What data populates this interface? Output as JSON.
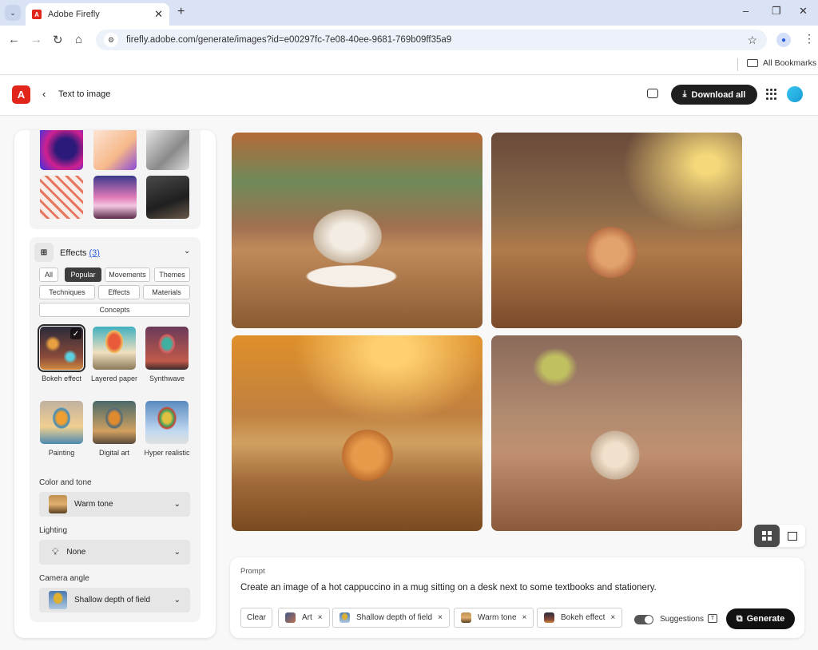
{
  "browser": {
    "tab_title": "Adobe Firefly",
    "url": "firefly.adobe.com/generate/images?id=e00297fc-7e08-40ee-9681-769b09ff35a9",
    "bookmarks_label": "All Bookmarks"
  },
  "header": {
    "logo_glyph": "A",
    "back_glyph": "<",
    "title": "Text to image",
    "download_all_label": "Download all",
    "accent_color": "#e1251b"
  },
  "sidebar": {
    "style_thumbs": [
      {
        "name": "neon-figure"
      },
      {
        "name": "thumbs-up-3d"
      },
      {
        "name": "sketch-portrait"
      },
      {
        "name": "pattern-figures"
      },
      {
        "name": "pink-clouds"
      },
      {
        "name": "man-portrait"
      }
    ],
    "effects": {
      "title": "Effects",
      "count": "(3)",
      "filters": [
        {
          "label": "All",
          "active": false
        },
        {
          "label": "Popular",
          "active": true
        },
        {
          "label": "Movements",
          "active": false
        },
        {
          "label": "Themes",
          "active": false
        },
        {
          "label": "Techniques",
          "active": false
        },
        {
          "label": "Effects",
          "active": false
        },
        {
          "label": "Materials",
          "active": false
        },
        {
          "label": "Concepts",
          "active": false
        }
      ],
      "tiles": [
        {
          "label": "Bokeh effect",
          "selected": true
        },
        {
          "label": "Layered paper",
          "selected": false
        },
        {
          "label": "Synthwave",
          "selected": false
        },
        {
          "label": "Painting",
          "selected": false
        },
        {
          "label": "Digital art",
          "selected": false
        },
        {
          "label": "Hyper realistic",
          "selected": false
        }
      ]
    },
    "color_tone": {
      "label": "Color and tone",
      "value": "Warm tone"
    },
    "lighting": {
      "label": "Lighting",
      "value": "None"
    },
    "camera_angle": {
      "label": "Camera angle",
      "value": "Shallow depth of field"
    }
  },
  "images": [
    {
      "description": "Cappuccino cup on saucer with pencils and notebooks, blurred bokeh background"
    },
    {
      "description": "Steaming latte mug beside pencil holder and bookshelf"
    },
    {
      "description": "Orange mug of coffee with steam near books and pencils in warm sunlight"
    },
    {
      "description": "Latte art cup on saucer with open book, pen and pencil cup"
    }
  ],
  "view_toggle": {
    "active": "grid"
  },
  "prompt": {
    "label": "Prompt",
    "text": "Create an image of a hot cappuccino in a mug sitting on a desk next to some textbooks and stationery.",
    "clear_label": "Clear",
    "tags": [
      {
        "label": "Art"
      },
      {
        "label": "Shallow depth of field"
      },
      {
        "label": "Warm tone"
      },
      {
        "label": "Bokeh effect"
      }
    ],
    "suggestions_label": "Suggestions",
    "suggestions_on": true,
    "generate_label": "Generate"
  }
}
